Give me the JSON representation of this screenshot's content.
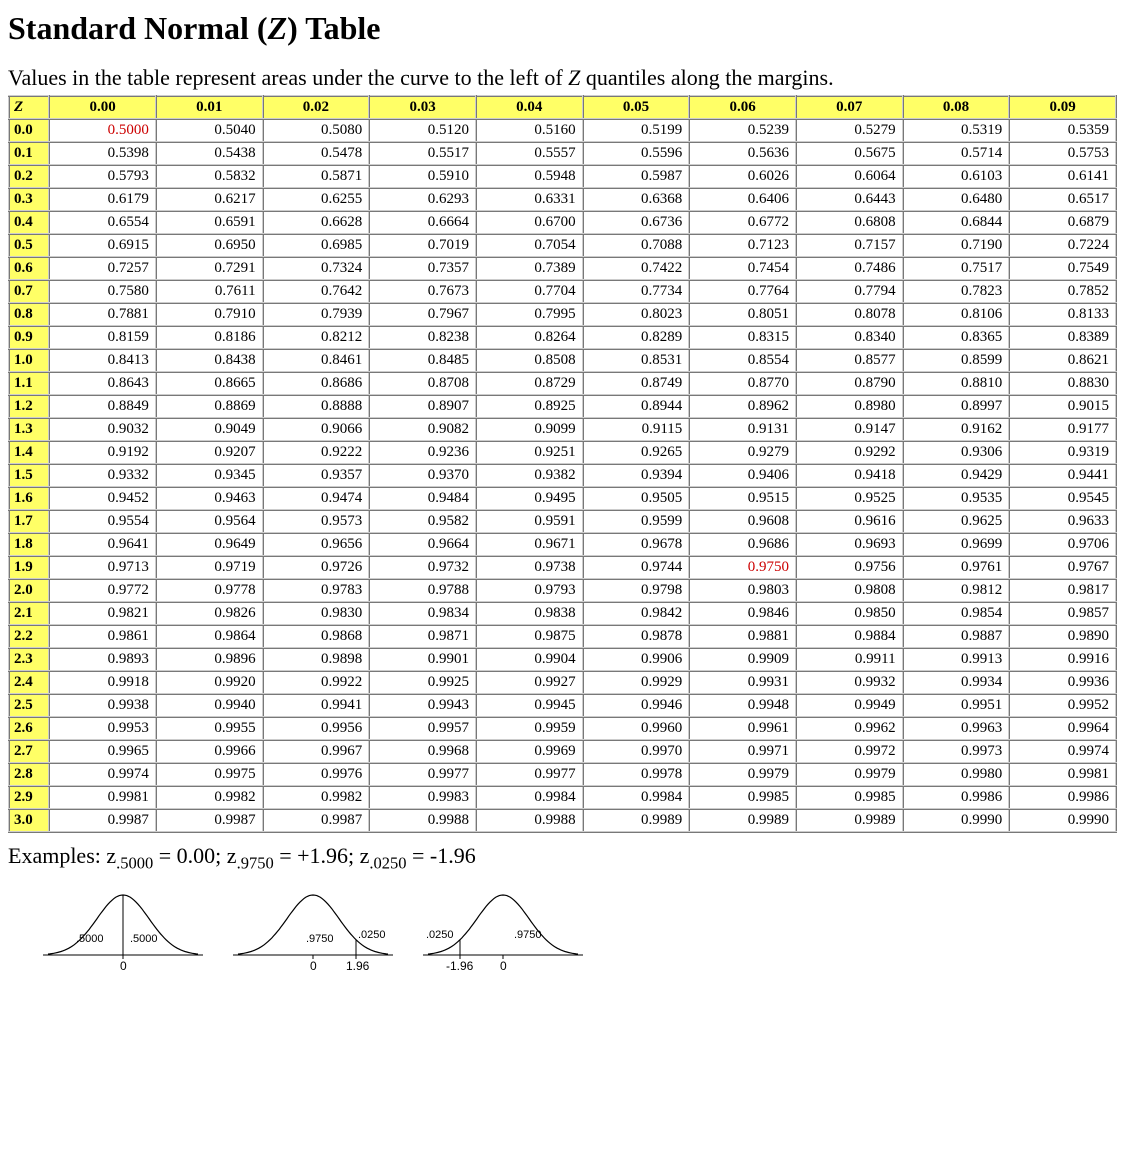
{
  "title_pre": "Standard Normal (",
  "title_z": "Z",
  "title_post": ") Table",
  "subtitle_pre": "Values in the table represent areas under the curve to the left of ",
  "subtitle_z": "Z",
  "subtitle_post": " quantiles along the margins.",
  "corner": "Z",
  "col_headers": [
    "0.00",
    "0.01",
    "0.02",
    "0.03",
    "0.04",
    "0.05",
    "0.06",
    "0.07",
    "0.08",
    "0.09"
  ],
  "row_headers": [
    "0.0",
    "0.1",
    "0.2",
    "0.3",
    "0.4",
    "0.5",
    "0.6",
    "0.7",
    "0.8",
    "0.9",
    "1.0",
    "1.1",
    "1.2",
    "1.3",
    "1.4",
    "1.5",
    "1.6",
    "1.7",
    "1.8",
    "1.9",
    "2.0",
    "2.1",
    "2.2",
    "2.3",
    "2.4",
    "2.5",
    "2.6",
    "2.7",
    "2.8",
    "2.9",
    "3.0"
  ],
  "cells": [
    [
      "0.5000",
      "0.5040",
      "0.5080",
      "0.5120",
      "0.5160",
      "0.5199",
      "0.5239",
      "0.5279",
      "0.5319",
      "0.5359"
    ],
    [
      "0.5398",
      "0.5438",
      "0.5478",
      "0.5517",
      "0.5557",
      "0.5596",
      "0.5636",
      "0.5675",
      "0.5714",
      "0.5753"
    ],
    [
      "0.5793",
      "0.5832",
      "0.5871",
      "0.5910",
      "0.5948",
      "0.5987",
      "0.6026",
      "0.6064",
      "0.6103",
      "0.6141"
    ],
    [
      "0.6179",
      "0.6217",
      "0.6255",
      "0.6293",
      "0.6331",
      "0.6368",
      "0.6406",
      "0.6443",
      "0.6480",
      "0.6517"
    ],
    [
      "0.6554",
      "0.6591",
      "0.6628",
      "0.6664",
      "0.6700",
      "0.6736",
      "0.6772",
      "0.6808",
      "0.6844",
      "0.6879"
    ],
    [
      "0.6915",
      "0.6950",
      "0.6985",
      "0.7019",
      "0.7054",
      "0.7088",
      "0.7123",
      "0.7157",
      "0.7190",
      "0.7224"
    ],
    [
      "0.7257",
      "0.7291",
      "0.7324",
      "0.7357",
      "0.7389",
      "0.7422",
      "0.7454",
      "0.7486",
      "0.7517",
      "0.7549"
    ],
    [
      "0.7580",
      "0.7611",
      "0.7642",
      "0.7673",
      "0.7704",
      "0.7734",
      "0.7764",
      "0.7794",
      "0.7823",
      "0.7852"
    ],
    [
      "0.7881",
      "0.7910",
      "0.7939",
      "0.7967",
      "0.7995",
      "0.8023",
      "0.8051",
      "0.8078",
      "0.8106",
      "0.8133"
    ],
    [
      "0.8159",
      "0.8186",
      "0.8212",
      "0.8238",
      "0.8264",
      "0.8289",
      "0.8315",
      "0.8340",
      "0.8365",
      "0.8389"
    ],
    [
      "0.8413",
      "0.8438",
      "0.8461",
      "0.8485",
      "0.8508",
      "0.8531",
      "0.8554",
      "0.8577",
      "0.8599",
      "0.8621"
    ],
    [
      "0.8643",
      "0.8665",
      "0.8686",
      "0.8708",
      "0.8729",
      "0.8749",
      "0.8770",
      "0.8790",
      "0.8810",
      "0.8830"
    ],
    [
      "0.8849",
      "0.8869",
      "0.8888",
      "0.8907",
      "0.8925",
      "0.8944",
      "0.8962",
      "0.8980",
      "0.8997",
      "0.9015"
    ],
    [
      "0.9032",
      "0.9049",
      "0.9066",
      "0.9082",
      "0.9099",
      "0.9115",
      "0.9131",
      "0.9147",
      "0.9162",
      "0.9177"
    ],
    [
      "0.9192",
      "0.9207",
      "0.9222",
      "0.9236",
      "0.9251",
      "0.9265",
      "0.9279",
      "0.9292",
      "0.9306",
      "0.9319"
    ],
    [
      "0.9332",
      "0.9345",
      "0.9357",
      "0.9370",
      "0.9382",
      "0.9394",
      "0.9406",
      "0.9418",
      "0.9429",
      "0.9441"
    ],
    [
      "0.9452",
      "0.9463",
      "0.9474",
      "0.9484",
      "0.9495",
      "0.9505",
      "0.9515",
      "0.9525",
      "0.9535",
      "0.9545"
    ],
    [
      "0.9554",
      "0.9564",
      "0.9573",
      "0.9582",
      "0.9591",
      "0.9599",
      "0.9608",
      "0.9616",
      "0.9625",
      "0.9633"
    ],
    [
      "0.9641",
      "0.9649",
      "0.9656",
      "0.9664",
      "0.9671",
      "0.9678",
      "0.9686",
      "0.9693",
      "0.9699",
      "0.9706"
    ],
    [
      "0.9713",
      "0.9719",
      "0.9726",
      "0.9732",
      "0.9738",
      "0.9744",
      "0.9750",
      "0.9756",
      "0.9761",
      "0.9767"
    ],
    [
      "0.9772",
      "0.9778",
      "0.9783",
      "0.9788",
      "0.9793",
      "0.9798",
      "0.9803",
      "0.9808",
      "0.9812",
      "0.9817"
    ],
    [
      "0.9821",
      "0.9826",
      "0.9830",
      "0.9834",
      "0.9838",
      "0.9842",
      "0.9846",
      "0.9850",
      "0.9854",
      "0.9857"
    ],
    [
      "0.9861",
      "0.9864",
      "0.9868",
      "0.9871",
      "0.9875",
      "0.9878",
      "0.9881",
      "0.9884",
      "0.9887",
      "0.9890"
    ],
    [
      "0.9893",
      "0.9896",
      "0.9898",
      "0.9901",
      "0.9904",
      "0.9906",
      "0.9909",
      "0.9911",
      "0.9913",
      "0.9916"
    ],
    [
      "0.9918",
      "0.9920",
      "0.9922",
      "0.9925",
      "0.9927",
      "0.9929",
      "0.9931",
      "0.9932",
      "0.9934",
      "0.9936"
    ],
    [
      "0.9938",
      "0.9940",
      "0.9941",
      "0.9943",
      "0.9945",
      "0.9946",
      "0.9948",
      "0.9949",
      "0.9951",
      "0.9952"
    ],
    [
      "0.9953",
      "0.9955",
      "0.9956",
      "0.9957",
      "0.9959",
      "0.9960",
      "0.9961",
      "0.9962",
      "0.9963",
      "0.9964"
    ],
    [
      "0.9965",
      "0.9966",
      "0.9967",
      "0.9968",
      "0.9969",
      "0.9970",
      "0.9971",
      "0.9972",
      "0.9973",
      "0.9974"
    ],
    [
      "0.9974",
      "0.9975",
      "0.9976",
      "0.9977",
      "0.9977",
      "0.9978",
      "0.9979",
      "0.9979",
      "0.9980",
      "0.9981"
    ],
    [
      "0.9981",
      "0.9982",
      "0.9982",
      "0.9983",
      "0.9984",
      "0.9984",
      "0.9985",
      "0.9985",
      "0.9986",
      "0.9986"
    ],
    [
      "0.9987",
      "0.9987",
      "0.9987",
      "0.9988",
      "0.9988",
      "0.9989",
      "0.9989",
      "0.9989",
      "0.9990",
      "0.9990"
    ]
  ],
  "highlights": [
    {
      "row": 0,
      "col": 0
    },
    {
      "row": 19,
      "col": 6
    }
  ],
  "examples": {
    "prefix": "Examples: z",
    "parts": [
      {
        "sub": ".5000",
        "text": " = 0.00; z"
      },
      {
        "sub": ".9750",
        "text": " = +1.96; z"
      },
      {
        "sub": ".0250",
        "text": " = -1.96"
      }
    ]
  },
  "curves": [
    {
      "left_area": ".5000",
      "right_area": ".5000",
      "tick_left": "",
      "tick_center": "0",
      "tick_right": "",
      "split": 85
    },
    {
      "left_area": ".9750",
      "right_area": ".0250",
      "tick_left": "",
      "tick_center": "0",
      "tick_right": "1.96",
      "split": 128
    },
    {
      "left_area": ".0250",
      "right_area": ".9750",
      "tick_left": "-1.96",
      "tick_center": "0",
      "tick_right": "",
      "split": 42
    }
  ]
}
